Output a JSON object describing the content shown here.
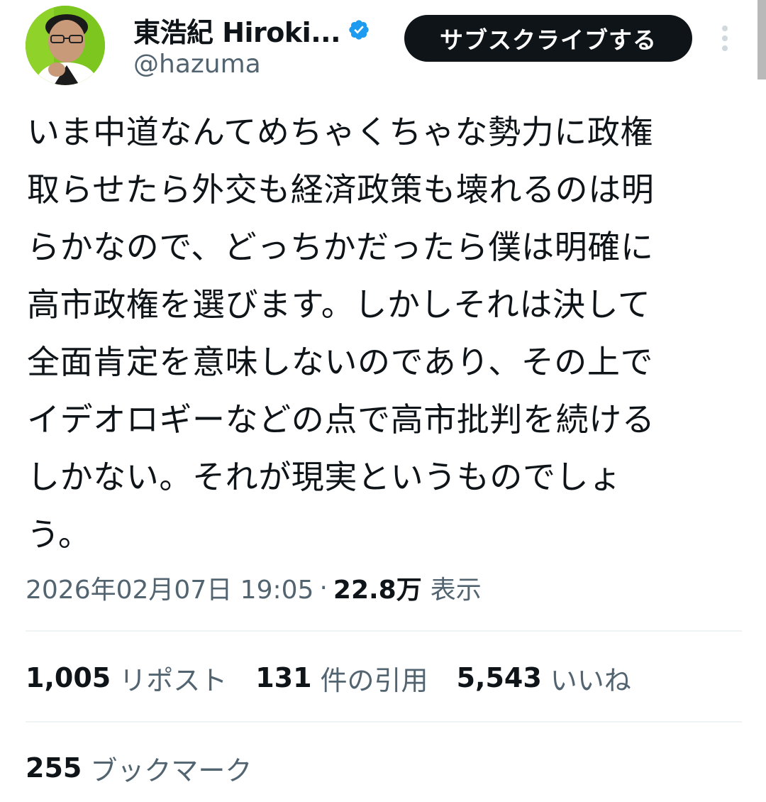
{
  "author": {
    "display_name": "東浩紀 Hiroki...",
    "handle": "@hazuma",
    "verified": true,
    "avatar_icon": "profile-photo",
    "verified_icon": "verified-badge-icon"
  },
  "actions": {
    "subscribe_label": "サブスクライブする",
    "more_icon": "more-vertical-icon"
  },
  "tweet": {
    "text": "いま中道なんてめちゃくちゃな勢力に政権\n取らせたら外交も経済政策も壊れるのは明\nらかなので、どっちかだったら僕は明確に\n高市政権を選びます。しかしそれは決して\n全面肯定を意味しないのであり、その上で\nイデオロギーなどの点で高市批判を続ける\nしかない。それが現実というものでしょ\nう。",
    "timestamp": "2026年02月07日 19:05",
    "separator": "·",
    "views_count": "22.8万",
    "views_label": "表示"
  },
  "stats": {
    "reposts": {
      "count": "1,005",
      "label": "リポスト"
    },
    "quotes": {
      "count": "131",
      "label": "件の引用"
    },
    "likes": {
      "count": "5,543",
      "label": "いいね"
    },
    "bookmarks": {
      "count": "255",
      "label": "ブックマーク"
    }
  },
  "colors": {
    "text": "#0f1419",
    "secondary_text": "#536471",
    "verified": "#1d9bf0",
    "button_bg": "#0f1419",
    "avatar_bg": "#7cc61f",
    "divider": "#eff3f4"
  }
}
